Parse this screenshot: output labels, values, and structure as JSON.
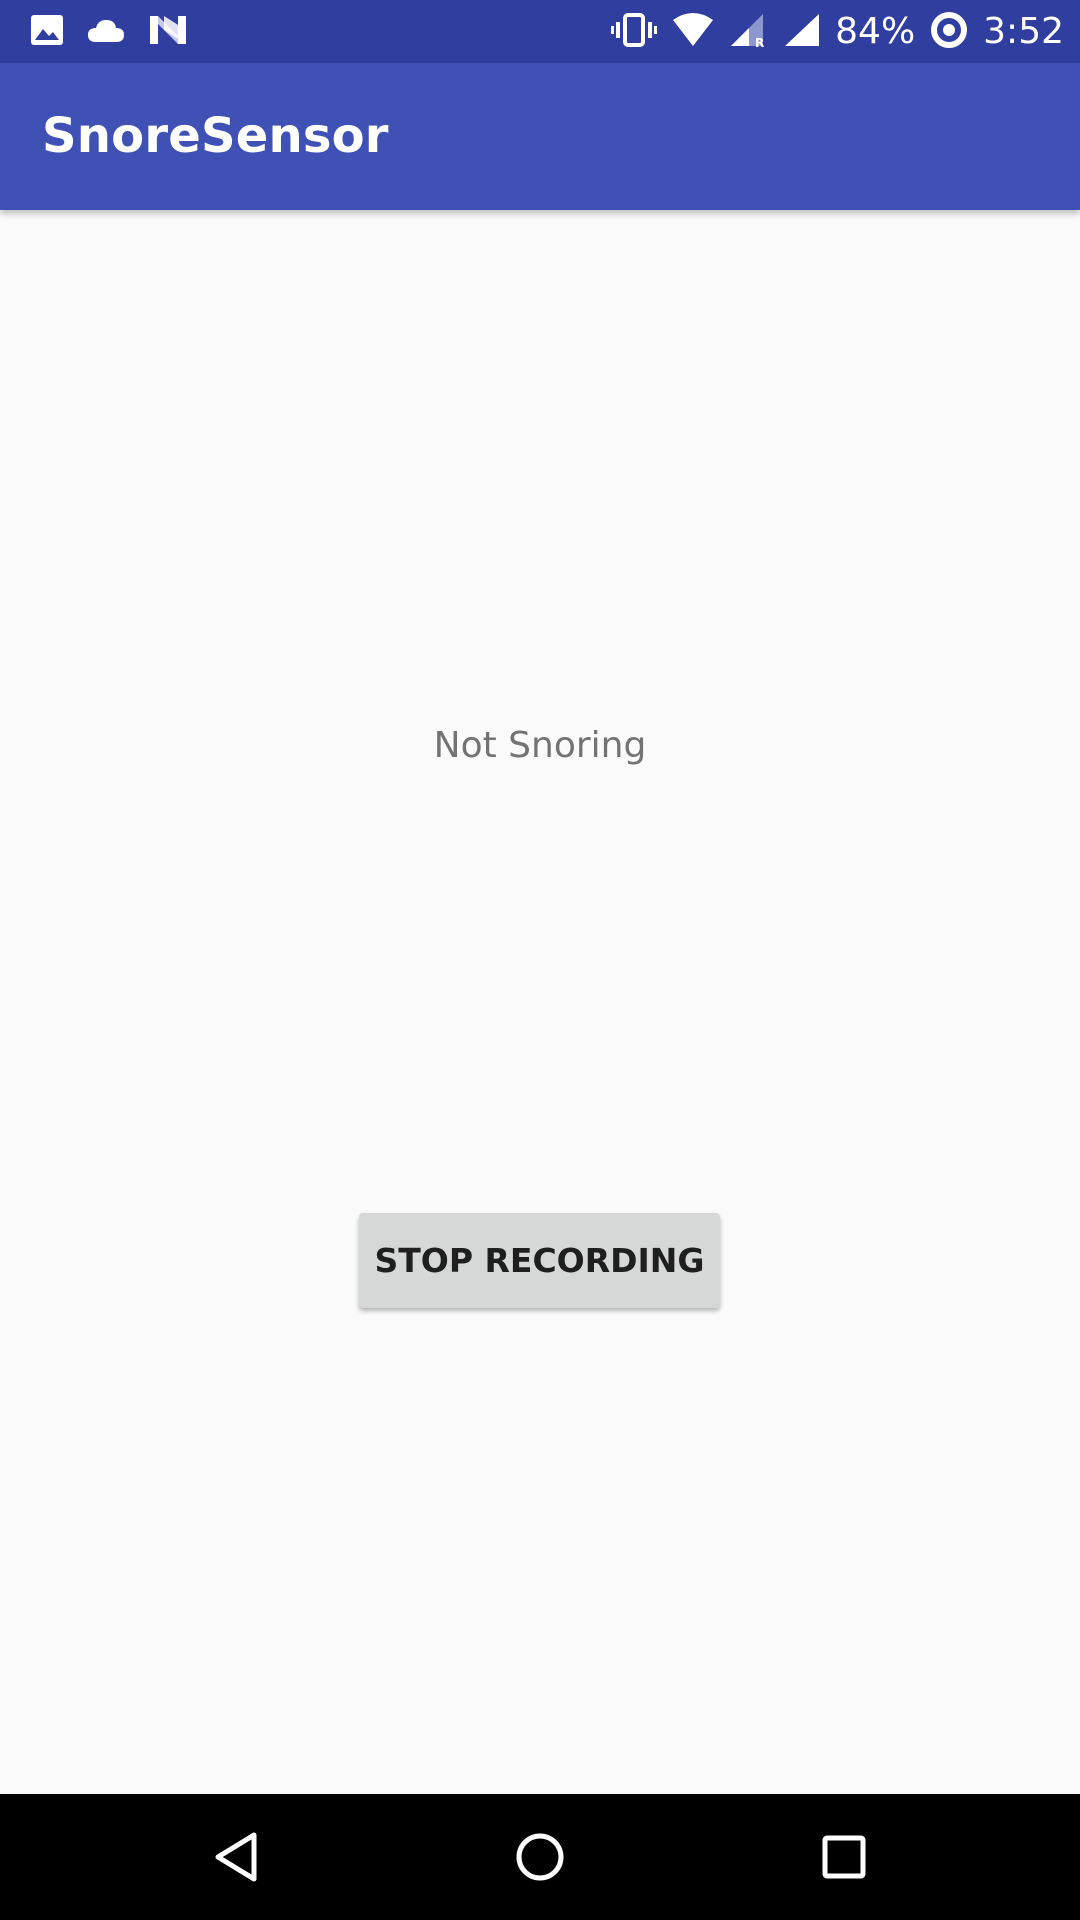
{
  "status_bar": {
    "battery_percent": "84%",
    "time": "3:52",
    "icons": [
      "image-notification-icon",
      "cloud-icon",
      "n-notification-icon",
      "vibrate-icon",
      "wifi-icon",
      "cell-signal-roaming-icon",
      "cell-signal-icon",
      "battery-ring-icon"
    ]
  },
  "app_bar": {
    "title": "SnoreSensor"
  },
  "main": {
    "status_text": "Not Snoring",
    "stop_button_label": "STOP RECORDING"
  },
  "nav_bar": {
    "buttons": [
      "back-icon",
      "home-icon",
      "recents-icon"
    ]
  },
  "colors": {
    "status_bar": "#303f9f",
    "app_bar": "#3f51b5",
    "background": "#fafafa",
    "button": "#d6d7d7"
  }
}
